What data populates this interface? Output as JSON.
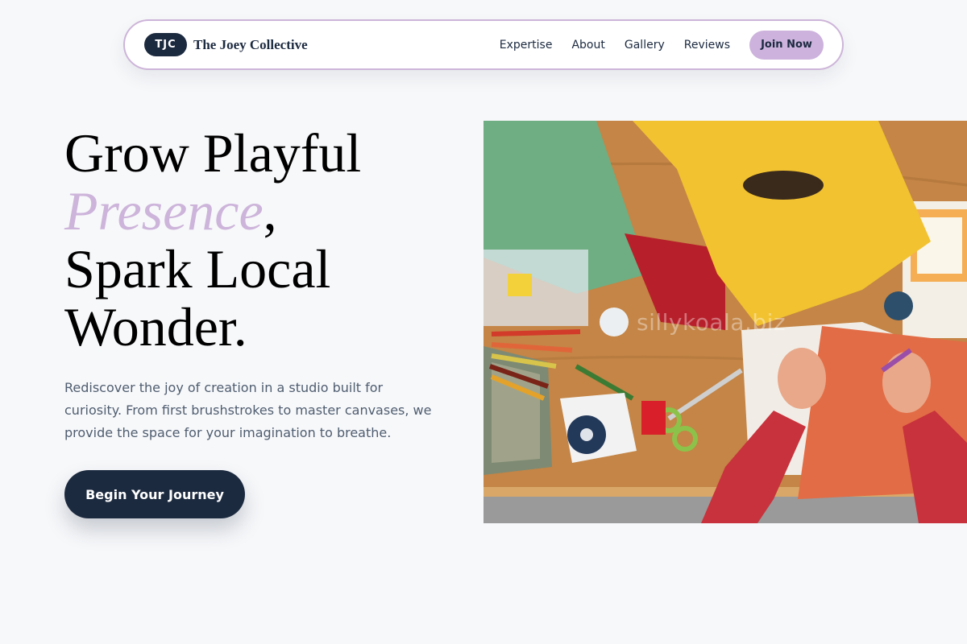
{
  "nav": {
    "badge": "TJC",
    "brand_name": "The Joey Collective",
    "links": [
      "Expertise",
      "About",
      "Gallery",
      "Reviews"
    ],
    "cta": "Join Now"
  },
  "hero": {
    "title_line1": "Grow Playful",
    "title_accent": "Presence",
    "title_comma": ",",
    "title_line3": "Spark Local",
    "title_line4": "Wonder.",
    "subtitle": "Rediscover the joy of creation in a studio built for curiosity. From first brushstrokes to master canvases, we provide the space for your imagination to breathe.",
    "cta": "Begin Your Journey",
    "watermark": "sillykoala.biz"
  },
  "colors": {
    "navy": "#1c2a40",
    "lavender": "#ccb2dc",
    "page_bg": "#f7f8fa",
    "body_text": "#4f5d70"
  }
}
